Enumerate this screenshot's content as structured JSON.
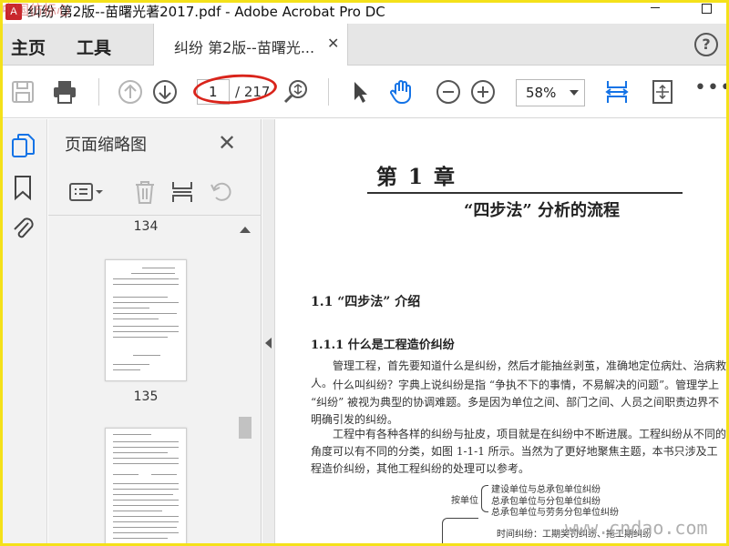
{
  "window": {
    "title": "纠纷 第2版--苗曙光著2017.pdf - Adobe Acrobat Pro DC",
    "watermark_top_left": "中国仿标心"
  },
  "menu": {
    "home": "主页",
    "tools": "工具",
    "doc_tab": "纠纷 第2版--苗曙光...",
    "help": "?"
  },
  "toolbar": {
    "current_page": "1",
    "total_pages": "/ 217",
    "zoom": "58%",
    "more": "•••"
  },
  "thumbnails_panel": {
    "title": "页面缩略图",
    "pages": [
      "134",
      "135"
    ]
  },
  "document": {
    "chapter_number": "第 1 章",
    "chapter_title": "“四步法” 分析的流程",
    "section_1": "1.1    “四步法” 介绍",
    "section_1_1": "1.1.1    什么是工程造价纠纷",
    "paragraphs": [
      "管理工程，首先要知道什么是纠纷，然后才能抽丝剥茧，准确地定位病灶、治病救人。",
      "什么叫纠纷？字典上说纠纷是指 “争执不下的事情，不易解决的问题”。管理学上 “纠纷” 被视为典型的协调难题。多是因为单位之间、部门之间、人员之间职责边界不明确引发的纠纷。",
      "工程中有各种各样的纠纷与扯皮，项目就是在纠纷中不断进展。工程纠纷从不同的角度可以有不同的分类，如图 1-1-1 所示。当然为了更好地聚焦主题，本书只涉及工程造价纠纷，其他工程纠纷的处理可以参考。"
    ],
    "diagram": {
      "group_label": "按单位",
      "items": [
        "建设单位与总承包单位纠纷",
        "总承包单位与分包单位纠纷",
        "总承包单位与劳务分包单位纠纷"
      ],
      "next_item": "时间纠纷：工期奖罚纠纷、拖工期纠纷"
    },
    "watermark": "www.cndao.com"
  },
  "colors": {
    "accent_blue": "#1473e6",
    "annotation_red": "#d9241b",
    "frame_yellow": "#f4e11a"
  }
}
